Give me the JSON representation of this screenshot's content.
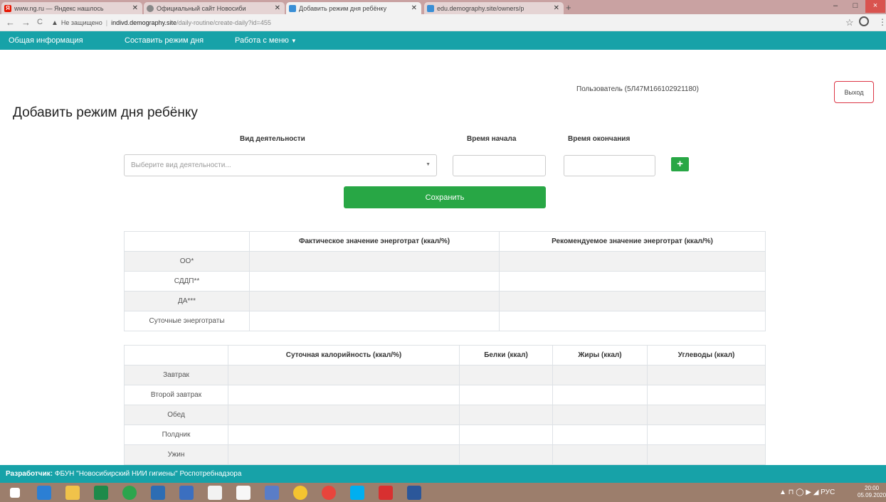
{
  "browser": {
    "tabs": [
      {
        "title": "www.ng.ru — Яндекс нашлось",
        "active": false
      },
      {
        "title": "Официальный сайт Новосиби",
        "active": false
      },
      {
        "title": "Добавить режим дня ребёнку",
        "active": true
      },
      {
        "title": "edu.demography.site/owners/p",
        "active": false
      }
    ],
    "new_tab": "+",
    "url_warning": "Не защищено",
    "url_host": "indivd.demography.site",
    "url_path": "/daily-routine/create-daily?id=455",
    "window": {
      "minimize": "–",
      "maximize": "□",
      "close": "×"
    }
  },
  "navbar": {
    "items": [
      "Общая информация",
      "Составить режим дня",
      "Работа с меню"
    ]
  },
  "header": {
    "user": "Пользователь (5Л47М166102921180)",
    "logout": "Выход"
  },
  "page": {
    "title": "Добавить режим дня ребёнку"
  },
  "form": {
    "activity_label": "Вид деятельности",
    "start_label": "Время начала",
    "end_label": "Время окончания",
    "activity_placeholder": "Выберите вид деятельности...",
    "add": "+",
    "save": "Сохранить"
  },
  "energy_table": {
    "headers": [
      "",
      "Фактическое значение энерготрат (ккал/%)",
      "Рекомендуемое значение энерготрат (ккал/%)"
    ],
    "rows": [
      "ОО*",
      "СДДП**",
      "ДА***",
      "Суточные энерготраты"
    ]
  },
  "meal_table": {
    "headers": [
      "",
      "Суточная калорийность (ккал/%)",
      "Белки (ккал)",
      "Жиры (ккал)",
      "Углеводы (ккал)"
    ],
    "rows": [
      "Завтрак",
      "Второй завтрак",
      "Обед",
      "Полдник",
      "Ужин"
    ]
  },
  "footer": {
    "label": "Разработчик:",
    "text": " ФБУН \"Новосибирский НИИ гигиены\" Роспотребнадзора"
  },
  "taskbar": {
    "tray": "▲ ⊓ ◯ ▶ ◢ РУС",
    "time": "20:00",
    "date": "05.09.2020"
  },
  "colors": {
    "accent": "#17a2a8",
    "success": "#28a745",
    "danger": "#dc3545"
  }
}
